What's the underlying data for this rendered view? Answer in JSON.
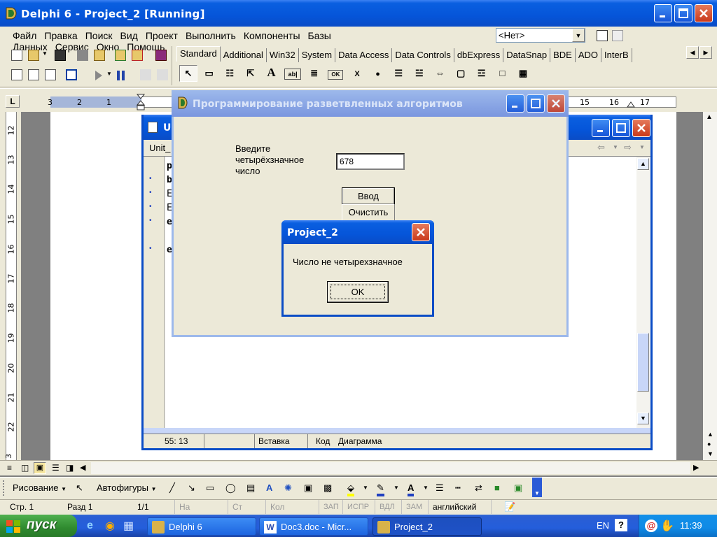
{
  "ide": {
    "title": "Delphi 6 - Project_2 [Running]",
    "menu": [
      "Файл",
      "Правка",
      "Поиск",
      "Вид",
      "Проект",
      "Выполнить",
      "Компоненты",
      "Базы Данных",
      "Сервис",
      "Окно",
      "Помощь"
    ],
    "config_dropdown": "<Нет>",
    "palette_tabs": [
      "Standard",
      "Additional",
      "Win32",
      "System",
      "Data Access",
      "Data Controls",
      "dbExpress",
      "DataSnap",
      "BDE",
      "ADO",
      "InterB"
    ],
    "palette_icons": [
      "A",
      "ab|",
      "OK",
      "X",
      "●"
    ]
  },
  "word": {
    "ruler_left": [
      "3",
      "2",
      "1"
    ],
    "ruler_right": [
      "15",
      "16",
      "17"
    ],
    "vruler": [
      "12",
      "13",
      "14",
      "15",
      "16",
      "17",
      "18",
      "19",
      "20",
      "21",
      "22",
      "3"
    ],
    "drawing_toolbar": {
      "draw": "Рисование",
      "autoshapes": "Автофигуры"
    },
    "status": {
      "page": "Стр. 1",
      "section": "Разд 1",
      "pages": "1/1",
      "at": "На",
      "line": "Ст",
      "col": "Кол",
      "rec": "ЗАП",
      "trk": "ИСПР",
      "ext": "ВДЛ",
      "ovr": "ЗАМ",
      "lang": "английский"
    }
  },
  "editor": {
    "title": "Ui",
    "tab": "Unit_",
    "code_lines": [
      "p",
      "b",
      "E",
      "E",
      "e",
      "",
      "e"
    ],
    "status": {
      "position": "55: 13",
      "mode": "Вставка"
    },
    "tabs": [
      "Код",
      "Диаграмма"
    ]
  },
  "app_form": {
    "title": "Программирование разветвленных алгоритмов",
    "prompt": "Введите четырёхзначное число",
    "input_value": "678",
    "enter_button": "Ввод",
    "clear_button": "Очистить"
  },
  "message_box": {
    "title": "Project_2",
    "message": "Число не четырехзначное",
    "ok_button": "OK"
  },
  "taskbar": {
    "start": "пуск",
    "tasks": [
      "Delphi 6",
      "Doc3.doc - Micr...",
      "Project_2"
    ],
    "lang": "EN",
    "time": "11:39"
  },
  "colors": {
    "accent": "#0a5fe0",
    "taskbar": "#245edb",
    "tray": "#0f8ae6",
    "start": "#3c9a3c"
  }
}
